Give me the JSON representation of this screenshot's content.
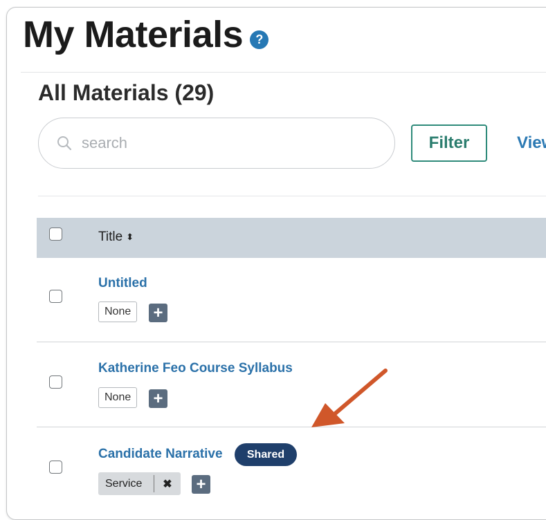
{
  "page": {
    "title": "My Materials",
    "help_glyph": "?"
  },
  "section": {
    "heading": "All Materials (29)"
  },
  "search": {
    "placeholder": "search"
  },
  "toolbar": {
    "filter_label": "Filter",
    "view_label": "View"
  },
  "table": {
    "columns": [
      {
        "label": "Title"
      }
    ]
  },
  "rows": [
    {
      "title": "Untitled",
      "tags": [
        {
          "label": "None"
        }
      ]
    },
    {
      "title": "Katherine Feo Course Syllabus",
      "tags": [
        {
          "label": "None"
        }
      ]
    },
    {
      "title": "Candidate Narrative",
      "badge": "Shared",
      "tags": [
        {
          "label": "Service",
          "removable": true
        }
      ]
    }
  ],
  "colors": {
    "accent": "#2678b4",
    "filter_border": "#2e8a7a",
    "header_bg": "#cbd4dc",
    "badge_bg": "#1f3f6b",
    "annotation_arrow": "#d0572a"
  }
}
